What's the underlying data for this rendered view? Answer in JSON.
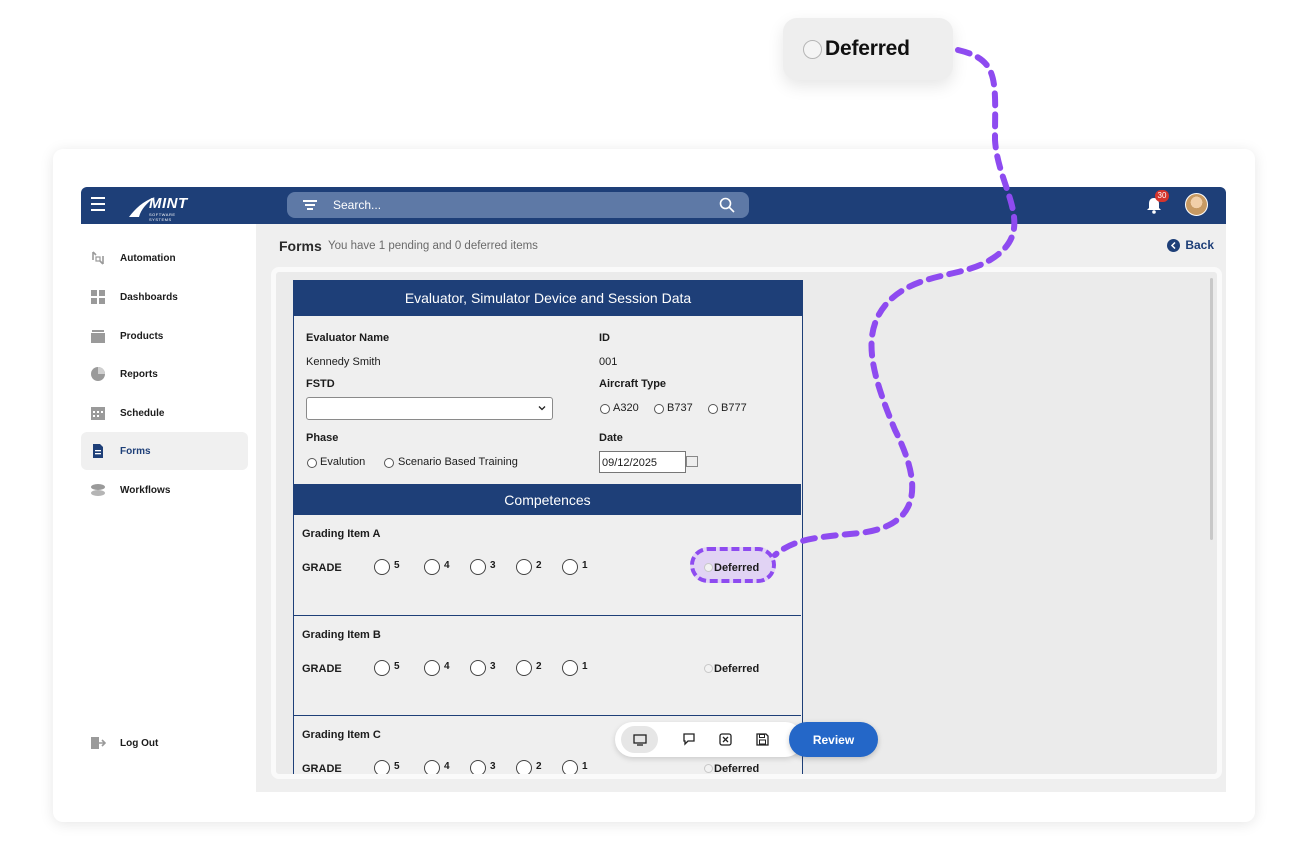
{
  "callout": {
    "label": "Deferred"
  },
  "topbar": {
    "logo_text": "MINT",
    "logo_sub": "SOFTWARE SYSTEMS",
    "search_placeholder": "Search...",
    "notification_count": "30"
  },
  "sidebar": {
    "items": [
      {
        "label": "Automation",
        "icon": "automation-icon"
      },
      {
        "label": "Dashboards",
        "icon": "dashboard-icon"
      },
      {
        "label": "Products",
        "icon": "products-icon"
      },
      {
        "label": "Reports",
        "icon": "reports-icon"
      },
      {
        "label": "Schedule",
        "icon": "calendar-icon"
      },
      {
        "label": "Forms",
        "icon": "document-icon",
        "active": true
      },
      {
        "label": "Workflows",
        "icon": "workflows-icon"
      }
    ],
    "logout": "Log Out"
  },
  "page": {
    "title": "Forms",
    "subtitle": "You have 1 pending and 0 deferred items",
    "back": "Back"
  },
  "form": {
    "section1_title": "Evaluator, Simulator Device and Session Data",
    "evaluator_label": "Evaluator Name",
    "evaluator_value": "Kennedy Smith",
    "id_label": "ID",
    "id_value": "001",
    "fstd_label": "FSTD",
    "aircraft_label": "Aircraft Type",
    "aircraft_options": [
      "A320",
      "B737",
      "B777"
    ],
    "phase_label": "Phase",
    "phase_options": [
      "Evalution",
      "Scenario Based Training"
    ],
    "date_label": "Date",
    "date_value": "09/12/2025",
    "section2_title": "Competences",
    "grading_items": [
      {
        "title": "Grading Item A",
        "grade_label": "GRADE",
        "grades": [
          "5",
          "4",
          "3",
          "2",
          "1"
        ],
        "deferred": "Deferred"
      },
      {
        "title": "Grading Item B",
        "grade_label": "GRADE",
        "grades": [
          "5",
          "4",
          "3",
          "2",
          "1"
        ],
        "deferred": "Deferred"
      },
      {
        "title": "Grading Item C",
        "grade_label": "GRADE",
        "grades": [
          "5",
          "4",
          "3",
          "2",
          "1"
        ],
        "deferred": "Deferred"
      }
    ]
  },
  "toolbar": {
    "buttons": [
      "monitor-icon",
      "comment-icon",
      "close-box-icon",
      "save-icon"
    ],
    "review": "Review"
  },
  "colors": {
    "navy": "#1e3f78",
    "accent_purple": "#8e4bf0",
    "review_blue": "#2467c8",
    "badge_red": "#d5342b"
  }
}
